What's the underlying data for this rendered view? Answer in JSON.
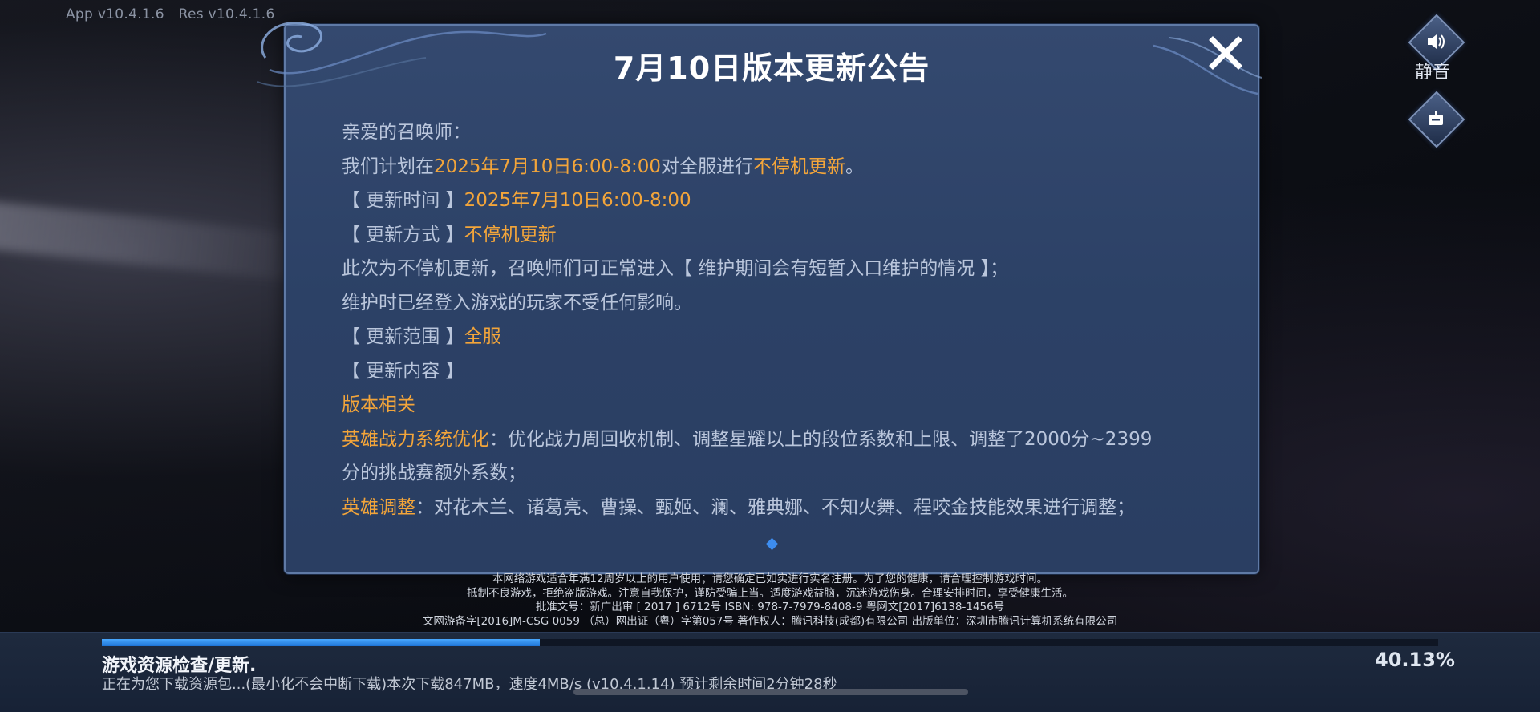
{
  "header": {
    "app_version": "App v10.4.1.6",
    "res_version": "Res v10.4.1.6"
  },
  "side_buttons": {
    "mute_icon": "speaker-icon",
    "mute_label": "静音",
    "second_icon": "robot-icon"
  },
  "dialog": {
    "title": "7月10日版本更新公告",
    "close_icon": "close-icon",
    "lines": [
      [
        {
          "t": "亲爱的召唤师：",
          "hl": false
        }
      ],
      [
        {
          "t": "我们计划在",
          "hl": false
        },
        {
          "t": "2025年7月10日6:00-8:00",
          "hl": true
        },
        {
          "t": "对全服进行",
          "hl": false
        },
        {
          "t": "不停机更新",
          "hl": true
        },
        {
          "t": "。",
          "hl": false
        }
      ],
      [
        {
          "t": "【 更新时间 】",
          "hl": false
        },
        {
          "t": "2025年7月10日6:00-8:00",
          "hl": true
        }
      ],
      [
        {
          "t": "【 更新方式 】",
          "hl": false
        },
        {
          "t": "不停机更新",
          "hl": true
        }
      ],
      [
        {
          "t": "此次为不停机更新，召唤师们可正常进入【 维护期间会有短暂入口维护的情况 】；",
          "hl": false
        }
      ],
      [
        {
          "t": "维护时已经登入游戏的玩家不受任何影响。",
          "hl": false
        }
      ],
      [
        {
          "t": "【 更新范围 】",
          "hl": false
        },
        {
          "t": "全服",
          "hl": true
        }
      ],
      [
        {
          "t": "【 更新内容 】",
          "hl": false
        }
      ],
      [
        {
          "t": "版本相关",
          "hl": true
        }
      ],
      [
        {
          "t": "英雄战力系统优化",
          "hl": true
        },
        {
          "t": "：优化战力周回收机制、调整星耀以上的段位系数和上限、调整了2000分~2399",
          "hl": false
        }
      ],
      [
        {
          "t": "分的挑战赛额外系数；",
          "hl": false
        }
      ],
      [
        {
          "t": "英雄调整",
          "hl": true
        },
        {
          "t": "：对花木兰、诸葛亮、曹操、甄姬、澜、雅典娜、不知火舞、程咬金技能效果进行调整；",
          "hl": false
        }
      ]
    ],
    "highlight_color": "#f3a53a"
  },
  "notice": {
    "line1": "本网络游戏适合年满12周岁以上的用户使用；请您确定已如实进行实名注册。为了您的健康，请合理控制游戏时间。",
    "line2": "抵制不良游戏，拒绝盗版游戏。注意自我保护，谨防受骗上当。适度游戏益脑，沉迷游戏伤身。合理安排时间，享受健康生活。",
    "line3": "批准文号：新广出审 [ 2017 ] 6712号  ISBN: 978-7-7979-8408-9  粤网文[2017]6138-1456号",
    "line4": "文网游备字[2016]M-CSG 0059 （总）网出证（粤）字第057号  著作权人：腾讯科技(成都)有限公司  出版单位：深圳市腾讯计算机系统有限公司"
  },
  "loading": {
    "title": "游戏资源检查/更新.",
    "detail": "正在为您下载资源包...(最小化不会中断下载)本次下载847MB，速度4MB/s (v10.4.1.14)  预计剩余时间2分钟28秒",
    "percent_text": "40.13%",
    "progress": 0.3275,
    "bar_color": "#2d8cf0"
  }
}
